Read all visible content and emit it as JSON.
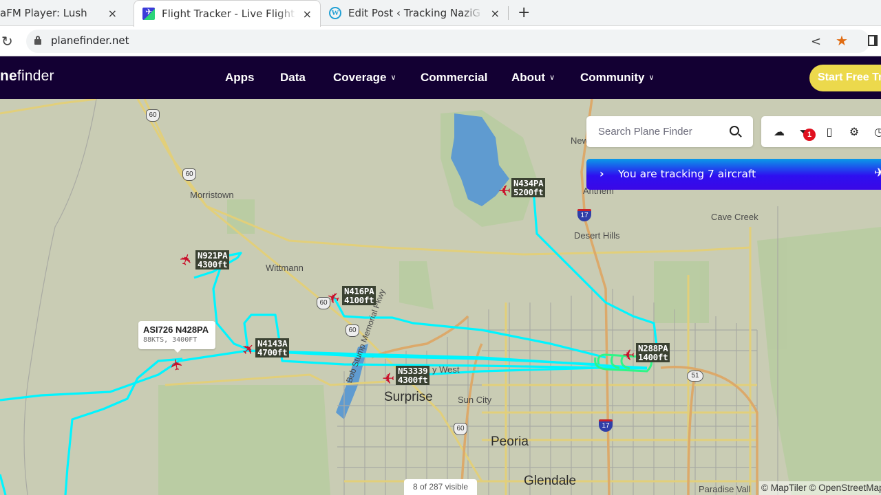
{
  "browser": {
    "tabs": [
      {
        "title": "aFM Player: Lush",
        "favicon": "radio-icon",
        "active": false
      },
      {
        "title": "Flight Tracker - Live Flight",
        "favicon": "planefinder-icon",
        "active": true
      },
      {
        "title": "Edit Post ‹ Tracking NaziG",
        "favicon": "wordpress-icon",
        "active": false
      }
    ],
    "new_tab_label": "+",
    "close_glyph": "×",
    "url": "planefinder.net"
  },
  "site": {
    "logo_bold": "ne",
    "logo_rest": "finder",
    "nav": [
      {
        "label": "Apps",
        "dropdown": false
      },
      {
        "label": "Data",
        "dropdown": false
      },
      {
        "label": "Coverage",
        "dropdown": true
      },
      {
        "label": "Commercial",
        "dropdown": false
      },
      {
        "label": "About",
        "dropdown": true
      },
      {
        "label": "Community",
        "dropdown": true
      }
    ],
    "cta_label": "Start Free Tr",
    "accent_color": "#ecd94c",
    "nav_bg_color": "#130033"
  },
  "map": {
    "search_placeholder": "Search Plane Finder",
    "filter_badge_count": "1",
    "tracking_text": "You are tracking 7 aircraft",
    "visible_count": "8 of 287 visible",
    "attribution": "© MapTiler © OpenStreetMap",
    "track_color": "#00f5ff",
    "aircraft_color": "#c9102b",
    "places": [
      {
        "name": "Morristown",
        "big": false
      },
      {
        "name": "Wittmann",
        "big": false
      },
      {
        "name": "Anthem",
        "big": false
      },
      {
        "name": "New",
        "big": false
      },
      {
        "name": "Desert Hills",
        "big": false
      },
      {
        "name": "Cave Creek",
        "big": false
      },
      {
        "name": "Surprise",
        "big": true
      },
      {
        "name": "Sun City",
        "big": false
      },
      {
        "name": "Peoria",
        "big": true
      },
      {
        "name": "Glendale",
        "big": true
      },
      {
        "name": "Paradise Vall",
        "big": false
      },
      {
        "name": "Bob Stump Memorial Pkwy",
        "big": false
      },
      {
        "name": "y West",
        "big": false
      }
    ],
    "route_shields": [
      "60",
      "60",
      "60",
      "60",
      "60",
      "17",
      "17",
      "51"
    ],
    "aircraft": [
      {
        "callsign": "N921PA",
        "altitude": "4300ft"
      },
      {
        "callsign": "N416PA",
        "altitude": "4100ft"
      },
      {
        "callsign": "N434PA",
        "altitude": "5200ft"
      },
      {
        "callsign": "N4143A",
        "altitude": "4700ft"
      },
      {
        "callsign": "N53339",
        "altitude": "4300ft"
      },
      {
        "callsign": "N288PA",
        "altitude": "1400ft"
      }
    ],
    "selected_popup": {
      "title": "ASI726 N428PA",
      "detail": "88KTS, 3400FT"
    }
  }
}
